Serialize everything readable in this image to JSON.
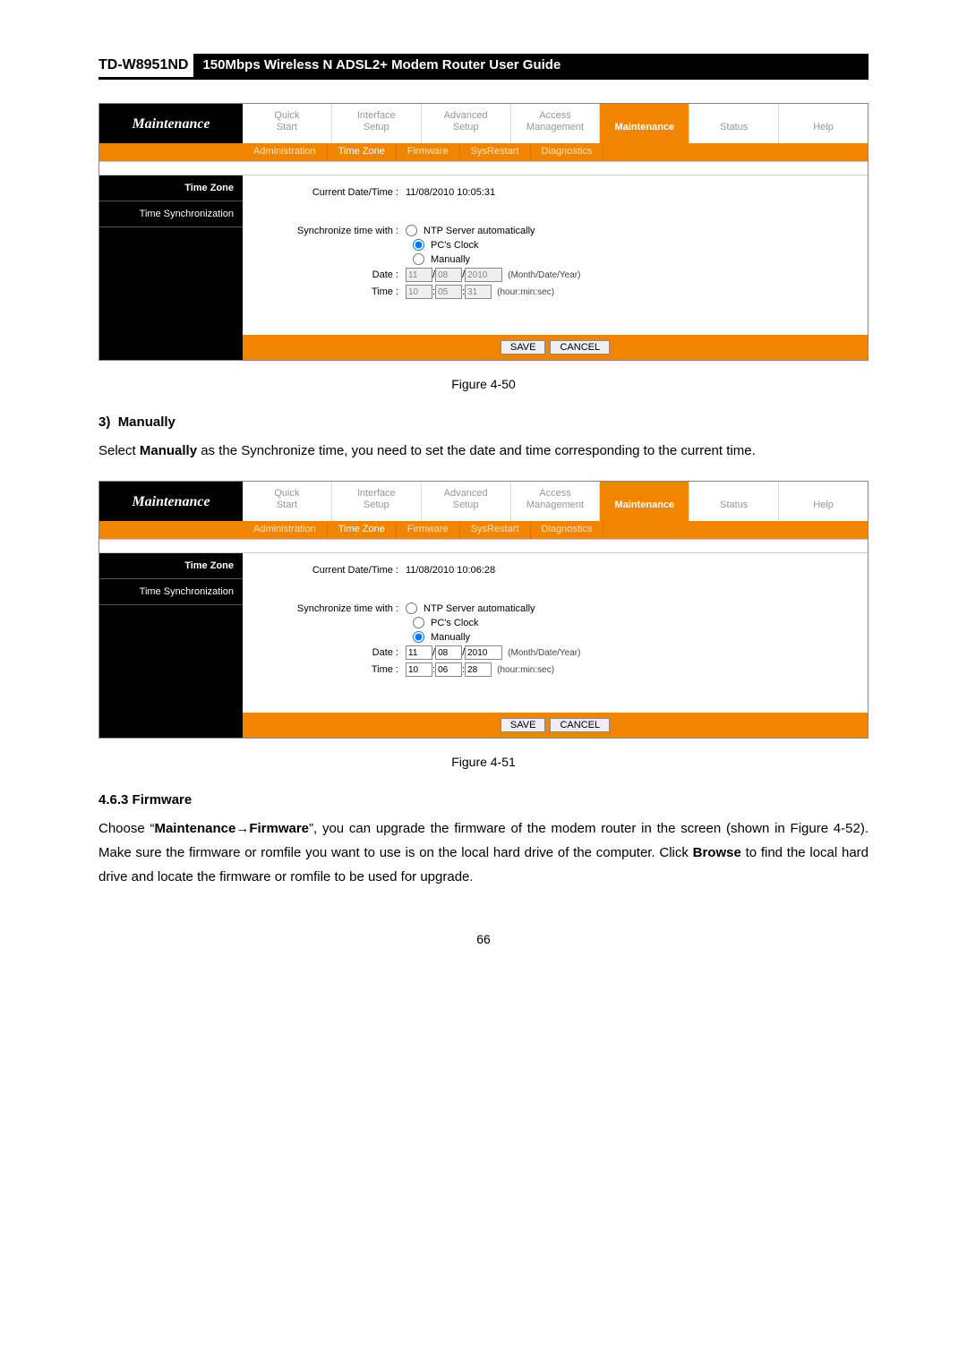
{
  "header": {
    "model": "TD-W8951ND",
    "title": "150Mbps Wireless N ADSL2+ Modem Router User Guide"
  },
  "router_brand": "Maintenance",
  "top_tabs": [
    "Quick Start",
    "Interface Setup",
    "Advanced Setup",
    "Access Management",
    "Maintenance",
    "Status",
    "Help"
  ],
  "top_tabs_twoline": [
    [
      "Quick",
      "Start"
    ],
    [
      "Interface",
      "Setup"
    ],
    [
      "Advanced",
      "Setup"
    ],
    [
      "Access",
      "Management"
    ],
    [
      "Maintenance",
      ""
    ],
    [
      "Status",
      ""
    ],
    [
      "Help",
      ""
    ]
  ],
  "top_tab_active": "Maintenance",
  "sub_tabs": [
    "Administration",
    "Time Zone",
    "Firmware",
    "SysRestart",
    "Diagnostics"
  ],
  "sub_tab_active": "Time Zone",
  "sidebar": {
    "heading": "Time Zone",
    "sub": "Time Synchronization"
  },
  "figure1": {
    "current_dt_label": "Current Date/Time :",
    "current_dt_value": "11/08/2010 10:05:31",
    "sync_label": "Synchronize time with :",
    "opts": {
      "ntp": "NTP Server automatically",
      "pc": "PC's Clock",
      "man": "Manually"
    },
    "selected": "pc",
    "date_label": "Date :",
    "time_label": "Time :",
    "date": {
      "m": "11",
      "d": "08",
      "y": "2010"
    },
    "time": {
      "h": "10",
      "m": "05",
      "s": "31"
    },
    "date_hint": "(Month/Date/Year)",
    "time_hint": "(hour:min:sec)",
    "save": "SAVE",
    "cancel": "CANCEL",
    "caption": "Figure 4-50"
  },
  "section3": {
    "num": "3)",
    "title": "Manually"
  },
  "para1_a": "Select ",
  "para1_b": "Manually",
  "para1_c": " as the Synchronize time, you need to set the date and time corresponding to the current time.",
  "figure2": {
    "current_dt_value": "11/08/2010 10:06:28",
    "selected": "man",
    "date": {
      "m": "11",
      "d": "08",
      "y": "2010"
    },
    "time": {
      "h": "10",
      "m": "06",
      "s": "28"
    },
    "caption": "Figure 4-51"
  },
  "h463": "4.6.3  Firmware",
  "para2_a": "Choose “",
  "para2_b": "Maintenance→Firmware",
  "para2_c": "”, you can upgrade the firmware of the modem router in the screen (shown in Figure 4-52). Make sure the firmware or romfile you want to use is on the local hard drive of the computer. Click ",
  "para2_d": "Browse",
  "para2_e": " to find the local hard drive and locate the firmware or romfile to be used for upgrade.",
  "page_number": "66"
}
